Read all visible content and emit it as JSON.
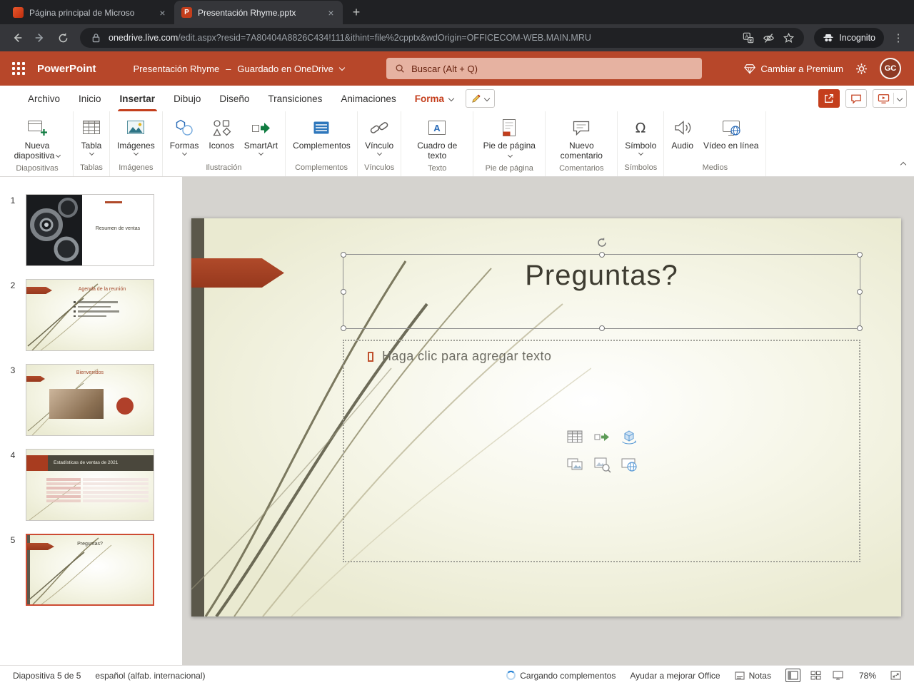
{
  "browser": {
    "tabs": [
      {
        "title": "Página principal de Microso"
      },
      {
        "title": "Presentación Rhyme.pptx"
      }
    ],
    "url_domain": "onedrive.live.com",
    "url_path": "/edit.aspx?resid=7A80404A8826C434!111&ithint=file%2cpptx&wdOrigin=OFFICECOM-WEB.MAIN.MRU",
    "incognito_label": "Incognito"
  },
  "header": {
    "app_name": "PowerPoint",
    "doc_title": "Presentación Rhyme",
    "separator": "–",
    "save_status": "Guardado en OneDrive",
    "search_placeholder": "Buscar (Alt + Q)",
    "premium_label": "Cambiar a Premium",
    "avatar_initials": "GC"
  },
  "ribbon": {
    "tabs": [
      "Archivo",
      "Inicio",
      "Insertar",
      "Dibujo",
      "Diseño",
      "Transiciones",
      "Animaciones"
    ],
    "contextual_tab": "Forma",
    "groups": [
      {
        "name": "Diapositivas",
        "buttons": [
          {
            "label": "Nueva diapositiva"
          }
        ]
      },
      {
        "name": "Tablas",
        "buttons": [
          {
            "label": "Tabla"
          }
        ]
      },
      {
        "name": "Imágenes",
        "buttons": [
          {
            "label": "Imágenes"
          }
        ]
      },
      {
        "name": "Ilustración",
        "buttons": [
          {
            "label": "Formas"
          },
          {
            "label": "Iconos"
          },
          {
            "label": "SmartArt"
          }
        ]
      },
      {
        "name": "Complementos",
        "buttons": [
          {
            "label": "Complementos"
          }
        ]
      },
      {
        "name": "Vínculos",
        "buttons": [
          {
            "label": "Vínculo"
          }
        ]
      },
      {
        "name": "Texto",
        "buttons": [
          {
            "label": "Cuadro de texto"
          }
        ]
      },
      {
        "name": "Pie de página",
        "buttons": [
          {
            "label": "Pie de página"
          }
        ]
      },
      {
        "name": "Comentarios",
        "buttons": [
          {
            "label": "Nuevo comentario"
          }
        ]
      },
      {
        "name": "Símbolos",
        "buttons": [
          {
            "label": "Símbolo"
          }
        ]
      },
      {
        "name": "Medios",
        "buttons": [
          {
            "label": "Audio"
          },
          {
            "label": "Vídeo en línea"
          }
        ]
      }
    ]
  },
  "slides": [
    {
      "num": "1",
      "title": "Resumen de ventas"
    },
    {
      "num": "2",
      "title": "Agenda de la reunión"
    },
    {
      "num": "3",
      "title": "Bienvenidos"
    },
    {
      "num": "4",
      "title": "Estadísticas de ventas de 2021"
    },
    {
      "num": "5",
      "title": "Preguntas?"
    }
  ],
  "canvas": {
    "slide_title": "Preguntas?",
    "body_placeholder": "Haga clic para agregar texto"
  },
  "statusbar": {
    "slide_counter": "Diapositiva 5 de 5",
    "language": "español (alfab. internacional)",
    "loading": "Cargando complementos",
    "improve": "Ayudar a mejorar Office",
    "notes": "Notas",
    "zoom": "78%"
  }
}
